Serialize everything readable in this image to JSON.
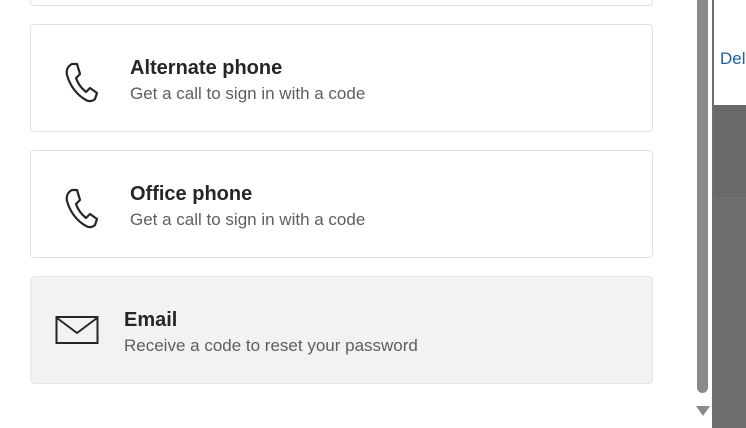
{
  "background": {
    "link_text": "Del"
  },
  "options": [
    {
      "title": "Alternate phone",
      "description": "Get a call to sign in with a code",
      "icon": "phone-icon"
    },
    {
      "title": "Office phone",
      "description": "Get a call to sign in with a code",
      "icon": "phone-icon"
    },
    {
      "title": "Email",
      "description": "Receive a code to reset your password",
      "icon": "envelope-icon"
    }
  ],
  "colors": {
    "selected_background": "#f3f2f1",
    "link": "#1d5fa8"
  }
}
